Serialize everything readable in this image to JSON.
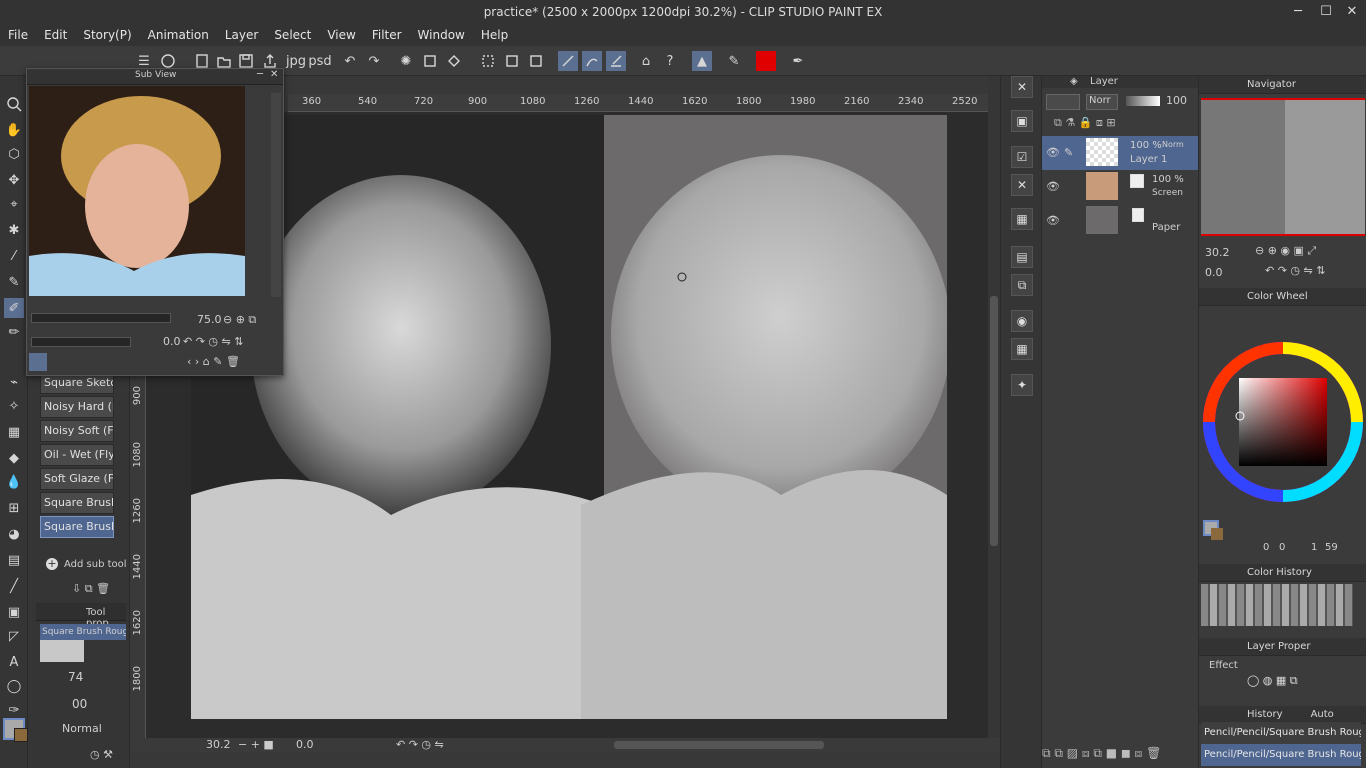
{
  "window": {
    "title": "practice* (2500 x 2000px 1200dpi 30.2%) - CLIP STUDIO PAINT EX",
    "minimize": "─",
    "maximize": "☐",
    "close": "✕"
  },
  "menu": [
    "File",
    "Edit",
    "Story(P)",
    "Animation",
    "Layer",
    "Select",
    "View",
    "Filter",
    "Window",
    "Help"
  ],
  "subview": {
    "title": "Sub View",
    "zoom": "75.0",
    "rotation": "0.0"
  },
  "subtools": {
    "brushes": [
      "Square Sketch",
      "Noisy Hard (F",
      "Noisy Soft (Fly",
      "Oil - Wet (Fly)",
      "Soft Glaze (Fl",
      "Square Brush",
      "Square Brush"
    ],
    "add_label": "Add sub tool",
    "tool_property_tab": "Tool prop",
    "current_brush": "Square Brush Rough (F",
    "size": "74",
    "opacity": "00",
    "blend": "Normal"
  },
  "ruler": {
    "h_ticks": [
      "360",
      "540",
      "720",
      "900",
      "1080",
      "1260",
      "1440",
      "1620",
      "1800",
      "1980",
      "2160",
      "2340",
      "2520"
    ],
    "v_ticks": [
      "900",
      "1080",
      "1260",
      "1440",
      "1620",
      "1800"
    ]
  },
  "status": {
    "zoom": "30.2",
    "rotation": "0.0"
  },
  "layer_panel": {
    "title": "Layer",
    "blend_mode": "Norr",
    "opacity": "100",
    "layers": [
      {
        "opacity": "100 %",
        "mode": "Norm",
        "name": "Layer 1"
      },
      {
        "opacity": "100 %",
        "mode": "Screen",
        "name": ""
      },
      {
        "opacity": "",
        "mode": "",
        "name": "Paper"
      }
    ]
  },
  "navigator": {
    "title": "Navigator",
    "zoom": "30.2",
    "angle": "0.0"
  },
  "color_wheel": {
    "title": "Color Wheel",
    "values": [
      "0",
      "0",
      "1",
      "59"
    ]
  },
  "color_history": {
    "title": "Color History"
  },
  "layer_property": {
    "title": "Layer Proper",
    "effect": "Effect"
  },
  "history": {
    "title": "History",
    "auto_action": "Auto Action",
    "items": [
      "Pencil/Pencil/Square Brush Rough (Fly)",
      "Pencil/Pencil/Square Brush Rough (Fly)"
    ]
  },
  "colors": {
    "accent": "#5b6f91",
    "main_color": "#b0b0b0",
    "sub_color": "#8a6a3c"
  }
}
